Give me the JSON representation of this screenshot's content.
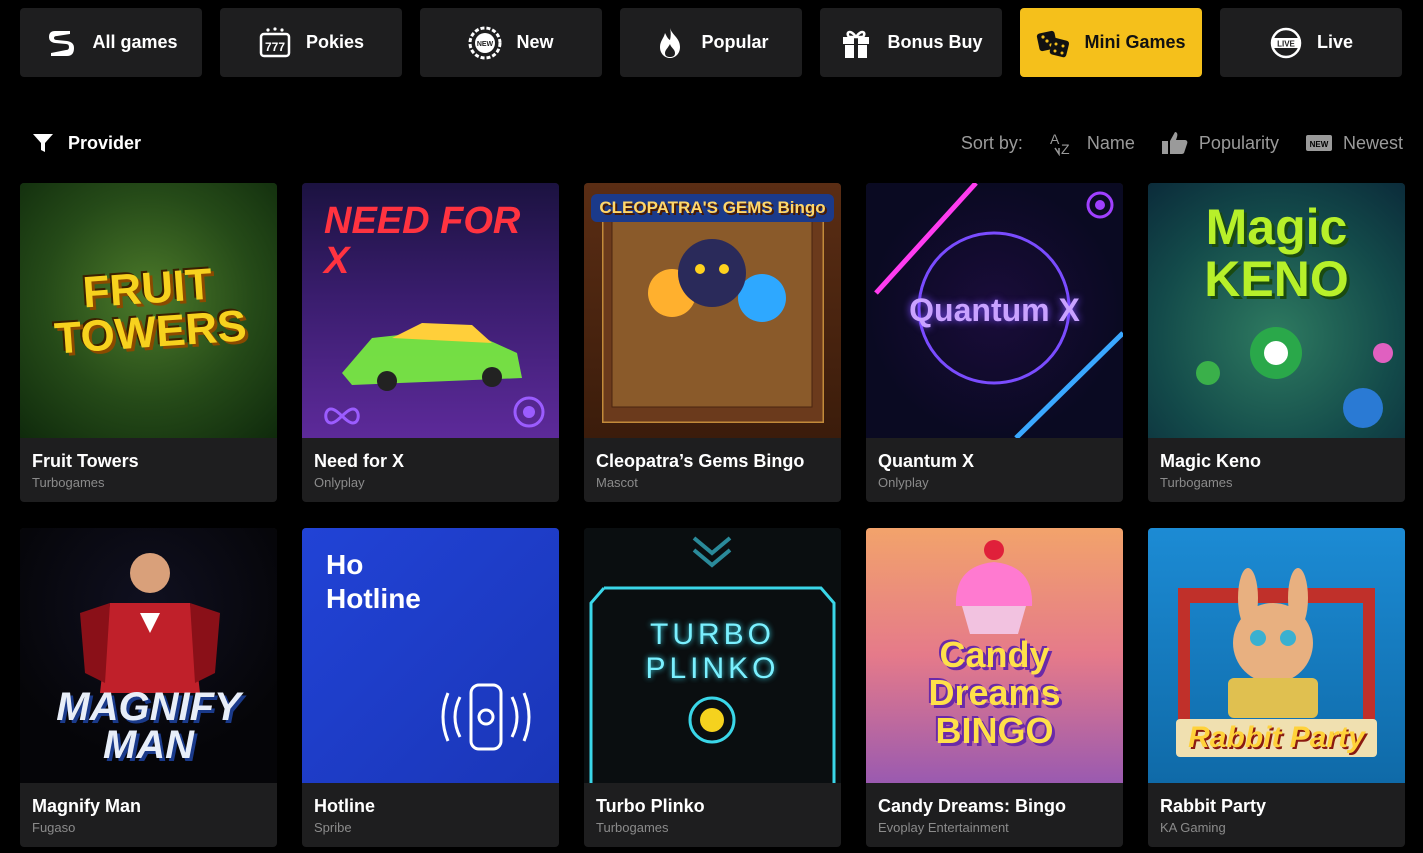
{
  "tabs": [
    {
      "label": "All games",
      "icon": "s-logo-icon",
      "active": false
    },
    {
      "label": "Pokies",
      "icon": "slot-777-icon",
      "active": false
    },
    {
      "label": "New",
      "icon": "new-badge-icon",
      "active": false
    },
    {
      "label": "Popular",
      "icon": "flame-icon",
      "active": false
    },
    {
      "label": "Bonus Buy",
      "icon": "gift-icon",
      "active": false
    },
    {
      "label": "Mini Games",
      "icon": "dice-icon",
      "active": true
    },
    {
      "label": "Live",
      "icon": "live-badge-icon",
      "active": false
    }
  ],
  "toolbar": {
    "provider_label": "Provider",
    "sort_label": "Sort by:",
    "sort_options": [
      {
        "label": "Name",
        "icon": "az-sort-icon"
      },
      {
        "label": "Popularity",
        "icon": "thumbs-up-icon"
      },
      {
        "label": "Newest",
        "icon": "new-badge-icon"
      }
    ]
  },
  "games": [
    {
      "name": "Fruit Towers",
      "provider": "Turbogames",
      "art_text": "FRUIT TOWERS"
    },
    {
      "name": "Need for X",
      "provider": "Onlyplay",
      "art_text": "NEED FOR X"
    },
    {
      "name": "Cleopatra’s Gems Bingo",
      "provider": "Mascot",
      "art_text": "CLEOPATRA'S GEMS Bingo"
    },
    {
      "name": "Quantum X",
      "provider": "Onlyplay",
      "art_text": "Quantum X"
    },
    {
      "name": "Magic Keno",
      "provider": "Turbogames",
      "art_text": "Magic KENO"
    },
    {
      "name": "Magnify Man",
      "provider": "Fugaso",
      "art_text": "MAGNIFY MAN"
    },
    {
      "name": "Hotline",
      "provider": "Spribe",
      "art_text": "Ho Hotline"
    },
    {
      "name": "Turbo Plinko",
      "provider": "Turbogames",
      "art_text": "TURBO PLINKO"
    },
    {
      "name": "Candy Dreams: Bingo",
      "provider": "Evoplay Entertainment",
      "art_text": "Candy Dreams BINGO"
    },
    {
      "name": "Rabbit Party",
      "provider": "KA Gaming",
      "art_text": "Rabbit Party"
    }
  ],
  "colors": {
    "accent": "#f5c01b",
    "card_bg": "#1e1e1f",
    "page_bg": "#000000",
    "muted": "#9a9a9a"
  }
}
